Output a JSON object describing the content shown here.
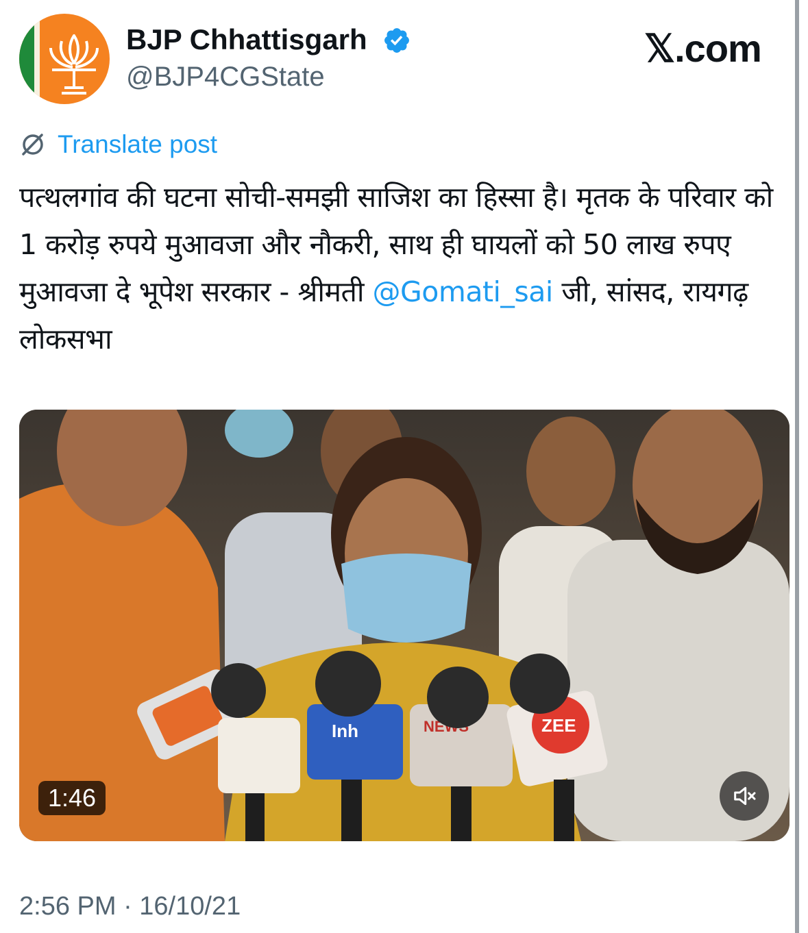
{
  "tweet": {
    "author_name": "BJP Chhattisgarh",
    "author_handle": "@BJP4CGState",
    "verified": true,
    "brand": "𝕏.com",
    "translate_label": "Translate post",
    "text_before_mention": "पत्थलगांव की घटना सोची-समझी साजिश का हिस्सा है। मृतक के परिवार को 1 करोड़ रुपये मुआवजा और नौकरी, साथ ही घायलों को 50 लाख रुपए मुआवजा दे भूपेश सरकार - श्रीमती ",
    "mention": "@Gomati_sai",
    "text_after_mention": " जी, सांसद, रायगढ़ लोकसभा",
    "video": {
      "duration": "1:46",
      "muted": true,
      "mic_labels": [
        "Inh",
        "NEWS",
        "ZEE"
      ]
    },
    "timestamp": "2:56 PM · 16/10/21"
  },
  "colors": {
    "link": "#1d9bf0",
    "secondary_text": "#536471",
    "avatar_saffron": "#f58220",
    "avatar_green": "#1f8a3a"
  },
  "icons": {
    "verified": "verified-badge-icon",
    "translate": "globe-slash-icon",
    "mute": "speaker-muted-icon"
  }
}
